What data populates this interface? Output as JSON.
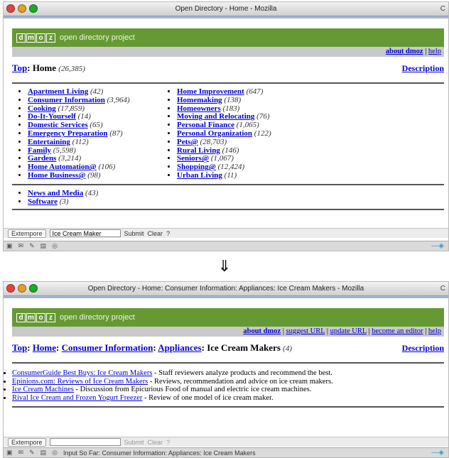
{
  "arrow": "⇓",
  "top_window": {
    "title": "Open Directory - Home - Mozilla",
    "title_right": "C",
    "tagline": "open directory project",
    "logo_letters": [
      "d",
      "m",
      "o",
      "z"
    ],
    "links": [
      {
        "label": "about dmoz",
        "bold": true
      },
      {
        "label": "help",
        "bold": false
      }
    ],
    "link_sep": " | ",
    "crumb_top": "Top",
    "crumb_sep": ": ",
    "crumb_current": "Home",
    "crumb_count": "(26,385)",
    "description_link": "Description",
    "col1": [
      {
        "label": "Apartment Living",
        "count": "(42)"
      },
      {
        "label": "Consumer Information",
        "count": "(3,964)"
      },
      {
        "label": "Cooking",
        "count": "(17,859)"
      },
      {
        "label": "Do-It-Yourself",
        "count": "(14)"
      },
      {
        "label": "Domestic Services",
        "count": "(65)"
      },
      {
        "label": "Emergency Preparation",
        "count": "(87)"
      },
      {
        "label": "Entertaining",
        "count": "(112)"
      },
      {
        "label": "Family",
        "count": "(5,598)"
      },
      {
        "label": "Gardens",
        "count": "(3,214)"
      },
      {
        "label": "Home Automation@",
        "count": "(106)"
      },
      {
        "label": "Home Business@",
        "count": "(98)"
      }
    ],
    "col2": [
      {
        "label": "Home Improvement",
        "count": "(647)"
      },
      {
        "label": "Homemaking",
        "count": "(138)"
      },
      {
        "label": "Homeowners",
        "count": "(183)"
      },
      {
        "label": "Moving and Relocating",
        "count": "(76)"
      },
      {
        "label": "Personal Finance",
        "count": "(1,065)"
      },
      {
        "label": "Personal Organization",
        "count": "(122)"
      },
      {
        "label": "Pets@",
        "count": "(28,703)"
      },
      {
        "label": "Rural Living",
        "count": "(146)"
      },
      {
        "label": "Seniors@",
        "count": "(1,067)"
      },
      {
        "label": "Shopping@",
        "count": "(12,424)"
      },
      {
        "label": "Urban Living",
        "count": "(11)"
      }
    ],
    "extra": [
      {
        "label": "News and Media",
        "count": "(43)"
      },
      {
        "label": "Software",
        "count": "(3)"
      }
    ],
    "findbar": {
      "label": "Extempore",
      "value": "Ice Cream Maker",
      "submit": "Submit",
      "clear": "Clear",
      "help": "?"
    },
    "status_text": ""
  },
  "bottom_window": {
    "title": "Open Directory - Home: Consumer Information: Appliances: Ice Cream Makers - Mozilla",
    "title_right": "C",
    "tagline": "open directory project",
    "logo_letters": [
      "d",
      "m",
      "o",
      "z"
    ],
    "links": [
      {
        "label": "about dmoz",
        "bold": true
      },
      {
        "label": "suggest URL",
        "bold": false
      },
      {
        "label": "update URL",
        "bold": false
      },
      {
        "label": "become an editor",
        "bold": false
      },
      {
        "label": "help",
        "bold": false
      }
    ],
    "link_sep": " | ",
    "crumb_top": "Top",
    "crumb_home": "Home",
    "crumb_consumer": "Consumer Information",
    "crumb_appliances": "Appliances",
    "crumb_current": "Ice Cream Makers",
    "crumb_sep": ": ",
    "crumb_count": "(4)",
    "description_link": "Description",
    "sites": [
      {
        "title": "ConsumerGuide Best Buys: Ice Cream Makers",
        "desc": " - Staff reviewers analyze products and recommend the best."
      },
      {
        "title": "Epinions.com: Reviews of Ice Cream Makers",
        "desc": " - Reviews, recommendation and advice on ice cream makers."
      },
      {
        "title": "Ice Cream Machines",
        "desc": " - Discussion from Epicurious Food of manual and electric ice cream machines."
      },
      {
        "title": "Rival Ice Cream and Frozen Yogurt Freezer",
        "desc": " - Review of one model of ice cream maker."
      }
    ],
    "findbar": {
      "label": "Extempore",
      "value": "",
      "submit": "Submit",
      "clear": "Clear",
      "help": "?"
    },
    "status_text": "Input So Far: Consumer Information: Appliances: Ice Cream Makers"
  }
}
